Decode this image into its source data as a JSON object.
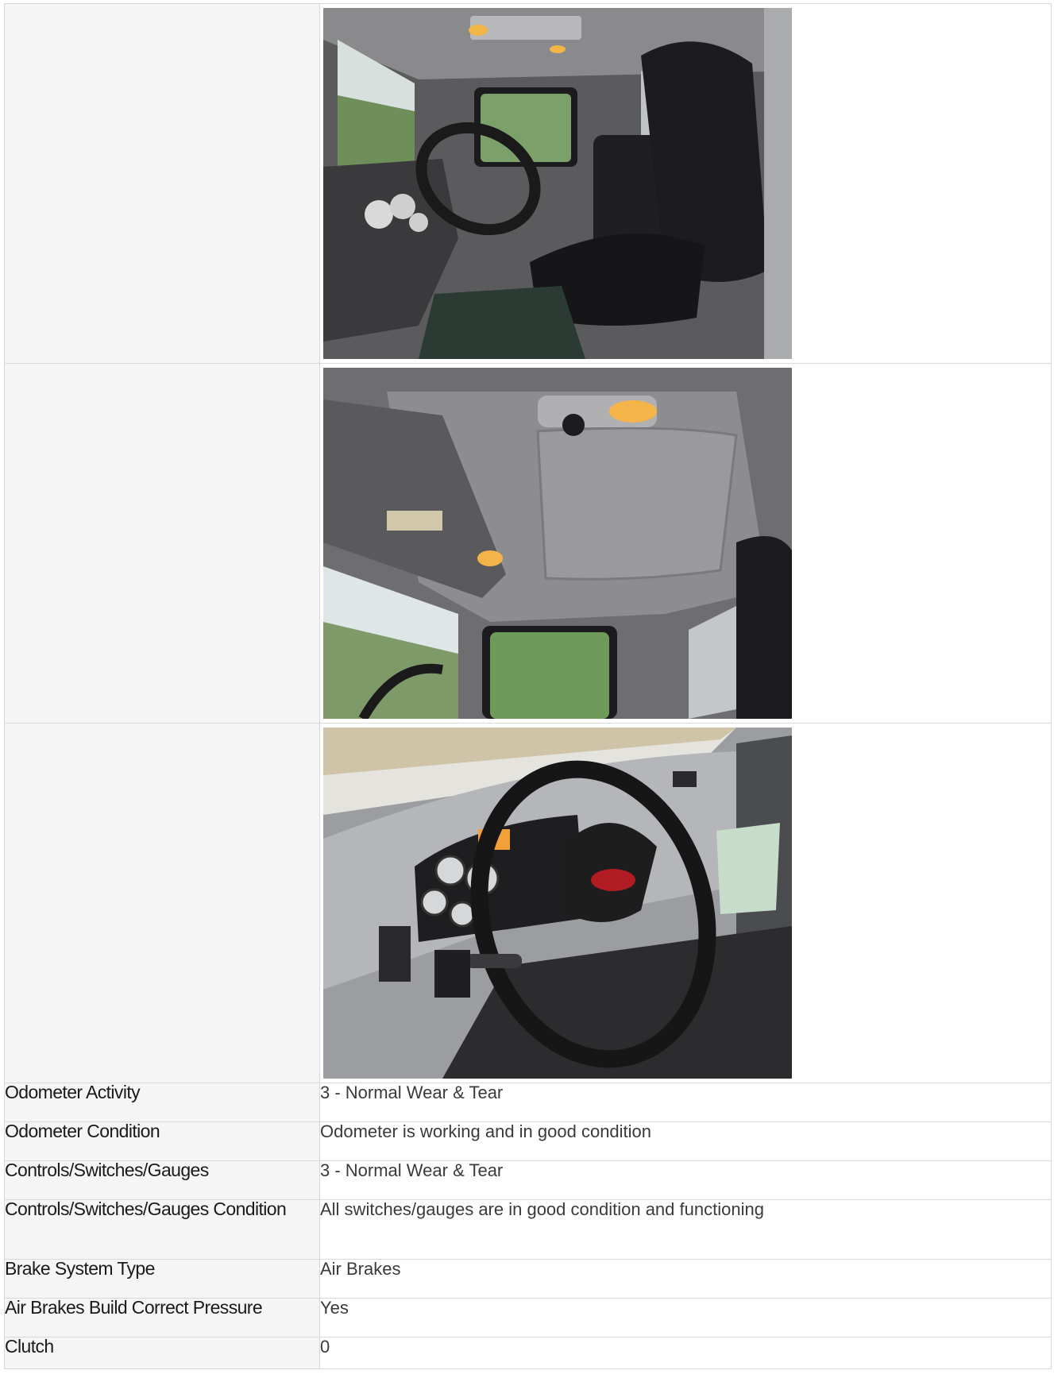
{
  "photo_rows": [
    {
      "label": "",
      "photo": "truck-cab-interior-seats-photo"
    },
    {
      "label": "",
      "photo": "truck-cab-headliner-photo"
    },
    {
      "label": "",
      "photo": "truck-dashboard-steering-wheel-photo"
    }
  ],
  "rows": [
    {
      "label": "Odometer Activity",
      "value": "3 - Normal Wear & Tear"
    },
    {
      "label": "Odometer Condition",
      "value": "Odometer is working and in good condition"
    },
    {
      "label": "Controls/Switches/Gauges",
      "value": "3 - Normal Wear & Tear"
    },
    {
      "label": "Controls/Switches/Gauges Condition",
      "value": "All switches/gauges are in good condition and functioning"
    },
    {
      "label": "Brake System Type",
      "value": "Air Brakes"
    },
    {
      "label": "Air Brakes Build Correct Pressure",
      "value": "Yes"
    },
    {
      "label": "Clutch",
      "value": "0"
    }
  ]
}
